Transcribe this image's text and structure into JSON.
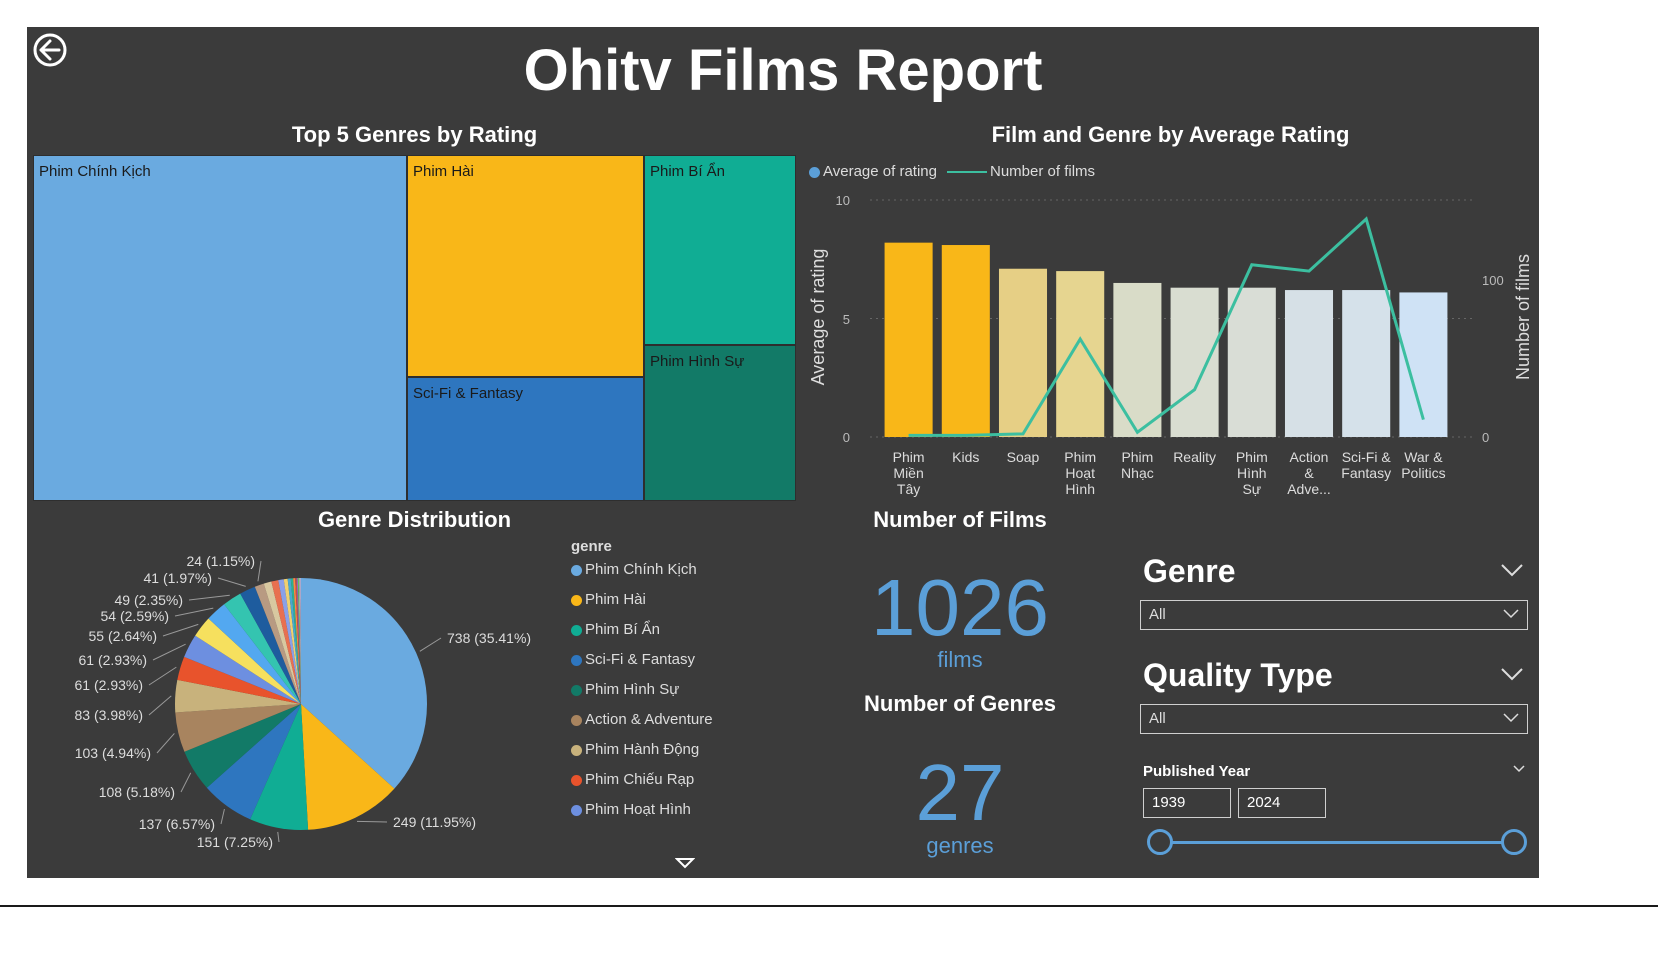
{
  "report": {
    "title": "Ohitv Films Report"
  },
  "treemap": {
    "title": "Top 5 Genres by Rating",
    "cells": [
      {
        "label": "Phim Chính Kịch",
        "color": "#6aaae0"
      },
      {
        "label": "Phim Hài",
        "color": "#f9b718"
      },
      {
        "label": "Phim Bí Ẩn",
        "color": "#10ad94"
      },
      {
        "label": "Sci-Fi & Fantasy",
        "color": "#2e76bf"
      },
      {
        "label": "Phim Hình Sự",
        "color": "#127a67"
      }
    ]
  },
  "combo": {
    "title": "Film and Genre by Average Rating",
    "legend": [
      {
        "label": "Average of rating",
        "color": "#5b9fd8"
      },
      {
        "label": "Number of films",
        "color": "#3cbfa0"
      }
    ],
    "y_left_label": "Average of rating",
    "y_right_label": "Number of films",
    "y_left_ticks": [
      "10",
      "5",
      "0"
    ],
    "y_right_ticks": [
      "100",
      "0"
    ]
  },
  "pie": {
    "title": "Genre Distribution",
    "legend_title": "genre",
    "legend_items": [
      {
        "label": "Phim Chính Kịch",
        "color": "#6aaae0"
      },
      {
        "label": "Phim Hài",
        "color": "#f9b718"
      },
      {
        "label": "Phim Bí Ẩn",
        "color": "#10ad94"
      },
      {
        "label": "Sci-Fi & Fantasy",
        "color": "#2e76bf"
      },
      {
        "label": "Phim Hình Sự",
        "color": "#127a67"
      },
      {
        "label": "Action & Adventure",
        "color": "#a8845f"
      },
      {
        "label": "Phim Hành Động",
        "color": "#c8b27c"
      },
      {
        "label": "Phim Chiếu Rạp",
        "color": "#e8532c"
      },
      {
        "label": "Phim Hoạt Hình",
        "color": "#6d8fe0"
      }
    ]
  },
  "kpis": {
    "films_title": "Number of Films",
    "films_value": "1026",
    "films_unit": "films",
    "genres_title": "Number of Genres",
    "genres_value": "27",
    "genres_unit": "genres"
  },
  "slicers": {
    "genre_title": "Genre",
    "genre_value": "All",
    "quality_title": "Quality Type",
    "quality_value": "All",
    "year_title": "Published Year",
    "year_from": "1939",
    "year_to": "2024"
  },
  "chart_data": [
    {
      "type": "bar",
      "title": "Film and Genre by Average Rating",
      "categories": [
        "Phim Miền Tây",
        "Kids",
        "Soap",
        "Phim Hoạt Hình",
        "Phim Nhạc",
        "Reality",
        "Phim Hình Sự",
        "Action & Adve...",
        "Sci-Fi & Fantasy",
        "War & Politics"
      ],
      "category_lines": [
        [
          "Phim",
          "Miền",
          "Tây"
        ],
        [
          "Kids"
        ],
        [
          "Soap"
        ],
        [
          "Phim",
          "Hoạt",
          "Hình"
        ],
        [
          "Phim",
          "Nhạc"
        ],
        [
          "Reality"
        ],
        [
          "Phim",
          "Hình",
          "Sự"
        ],
        [
          "Action",
          "&",
          "Adve..."
        ],
        [
          "Sci-Fi &",
          "Fantasy"
        ],
        [
          "War &",
          "Politics"
        ]
      ],
      "series": [
        {
          "name": "Average of rating",
          "axis": "left",
          "values": [
            8.2,
            8.1,
            7.1,
            7.0,
            6.5,
            6.3,
            6.3,
            6.2,
            6.2,
            6.1
          ],
          "colors": [
            "#f9b718",
            "#f9b718",
            "#e6cf85",
            "#e6d590",
            "#d9dcc8",
            "#d9ddd1",
            "#d9ddd6",
            "#d6e0e6",
            "#d5e1ea",
            "#cfe2f5"
          ]
        },
        {
          "name": "Number of films",
          "axis": "right",
          "type": "line",
          "values": [
            1,
            1,
            2,
            62,
            3,
            30,
            109,
            105,
            138,
            11
          ],
          "color": "#3cbfa0"
        }
      ],
      "ylim_left": [
        0,
        10
      ],
      "ylim_right": [
        0,
        150
      ]
    },
    {
      "type": "pie",
      "title": "Genre Distribution",
      "slices": [
        {
          "value": 738,
          "label": "738 (35.41%)",
          "color": "#6aaae0"
        },
        {
          "value": 249,
          "label": "249 (11.95%)",
          "color": "#f9b718"
        },
        {
          "value": 151,
          "label": "151 (7.25%)",
          "color": "#10ad94"
        },
        {
          "value": 137,
          "label": "137 (6.57%)",
          "color": "#2e76bf"
        },
        {
          "value": 108,
          "label": "108 (5.18%)",
          "color": "#127a67"
        },
        {
          "value": 103,
          "label": "103 (4.94%)",
          "color": "#a8845f"
        },
        {
          "value": 83,
          "label": "83 (3.98%)",
          "color": "#c8b27c"
        },
        {
          "value": 61,
          "label": "61 (2.93%)",
          "color": "#e8532c"
        },
        {
          "value": 61,
          "label": "61 (2.93%)",
          "color": "#6d8fe0"
        },
        {
          "value": 55,
          "label": "55 (2.64%)",
          "color": "#f6e05e"
        },
        {
          "value": 54,
          "label": "54 (2.59%)",
          "color": "#53a8f0"
        },
        {
          "value": 49,
          "label": "49 (2.35%)",
          "color": "#34c4b0"
        },
        {
          "value": 41,
          "label": "41 (1.97%)",
          "color": "#1e5c9e"
        },
        {
          "value": 24,
          "label": "24 (1.15%)",
          "color": "#b89a82"
        },
        {
          "value": 20,
          "label": "",
          "color": "#d8c8a0"
        },
        {
          "value": 18,
          "label": "",
          "color": "#e87050"
        },
        {
          "value": 14,
          "label": "",
          "color": "#8aa0e8"
        },
        {
          "value": 10,
          "label": "",
          "color": "#f0d070"
        },
        {
          "value": 8,
          "label": "",
          "color": "#4aa8d0"
        },
        {
          "value": 6,
          "label": "",
          "color": "#2fb090"
        },
        {
          "value": 5,
          "label": "",
          "color": "#ff8a40"
        },
        {
          "value": 4,
          "label": "",
          "color": "#c05050"
        },
        {
          "value": 3,
          "label": "",
          "color": "#9070c0"
        },
        {
          "value": 3,
          "label": "",
          "color": "#60c060"
        },
        {
          "value": 2,
          "label": "",
          "color": "#c0c0c0"
        },
        {
          "value": 2,
          "label": "",
          "color": "#e0a0c0"
        },
        {
          "value": 1,
          "label": "",
          "color": "#80d0ff"
        }
      ]
    }
  ]
}
